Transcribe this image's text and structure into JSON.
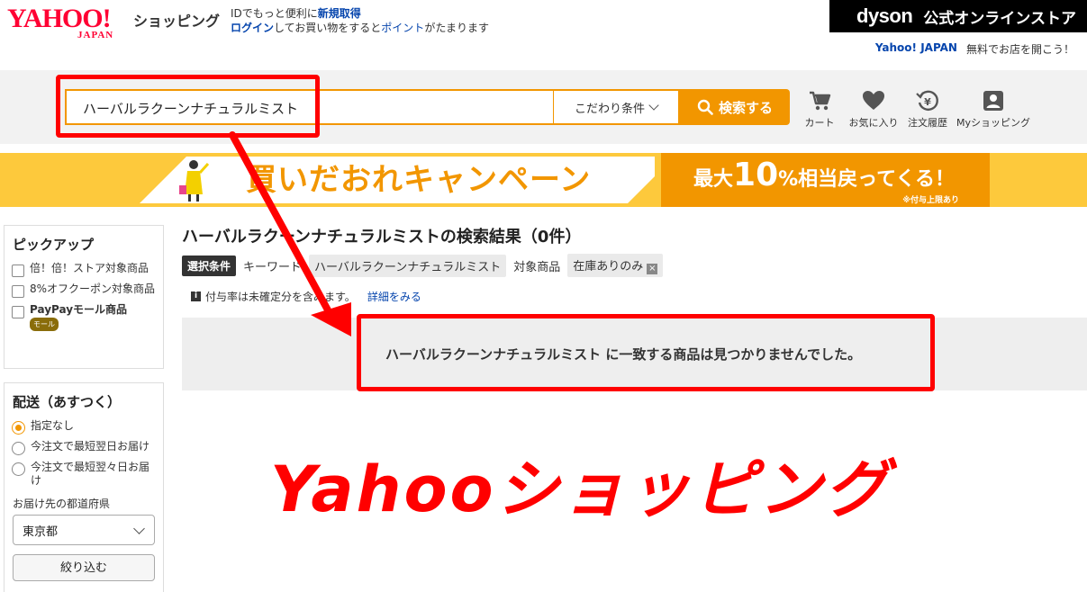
{
  "header": {
    "logo_main": "YAHOO!",
    "logo_sub": "JAPAN",
    "shop_label": "ショッピング",
    "promo_line1_prefix": "IDでもっと便利に",
    "promo_line1_link": "新規取得",
    "promo_line2_link1": "ログイン",
    "promo_line2_mid": "してお買い物をすると",
    "promo_line2_link2": "ポイント",
    "promo_line2_suffix": "がたまります",
    "dyson_logo": "dyson",
    "dyson_text": "公式オンラインストア",
    "yahoo_japan_link": "Yahoo! JAPAN",
    "open_store_link": "無料でお店を開こう！"
  },
  "search": {
    "value": "ハーバルラクーンナチュラルミスト",
    "filter_label": "こだわり条件",
    "button_label": "検索する"
  },
  "nav": [
    {
      "label": "カート",
      "icon": "cart-icon"
    },
    {
      "label": "お気に入り",
      "icon": "heart-icon"
    },
    {
      "label": "注文履歴",
      "icon": "order-history-icon"
    },
    {
      "label": "Myショッピング",
      "icon": "user-icon"
    }
  ],
  "banner": {
    "title": "買いだおれキャンペーン",
    "right_prefix": "最大",
    "right_number": "10",
    "right_suffix": "%相当戻ってくる！",
    "right_note": "※付与上限あり"
  },
  "sidebar": {
    "pickup_title": "ピックアップ",
    "pickup_items": [
      "倍！倍！ストア対象商品",
      "8%オフクーポン対象商品",
      "PayPayモール商品"
    ],
    "paypay_badge": "モール",
    "delivery_title": "配送（あすつく）",
    "delivery_options": [
      "指定なし",
      "今注文で最短翌日お届け",
      "今注文で最短翌々日お届け"
    ],
    "pref_label": "お届け先の都道府県",
    "pref_value": "東京都",
    "narrow_button": "絞り込む"
  },
  "results": {
    "title": "ハーバルラクーンナチュラルミストの検索結果（0件）",
    "cond_badge": "選択条件",
    "keyword_label": "キーワード",
    "keyword_value": "ハーバルラクーンナチュラルミスト",
    "target_label": "対象商品",
    "target_value": "在庫ありのみ",
    "note": "付与率は未確定分を含みます。",
    "note_link": "詳細をみる",
    "no_result": "ハーバルラクーンナチュラルミスト に一致する商品は見つかりませんでした。"
  },
  "annotation": {
    "caption": "Yahooショッピング",
    "color": "#ff0000"
  },
  "colors": {
    "brand_red": "#ff0033",
    "accent_orange": "#f29600",
    "banner_yellow": "#fdc93c",
    "link_blue": "#0645ad"
  }
}
